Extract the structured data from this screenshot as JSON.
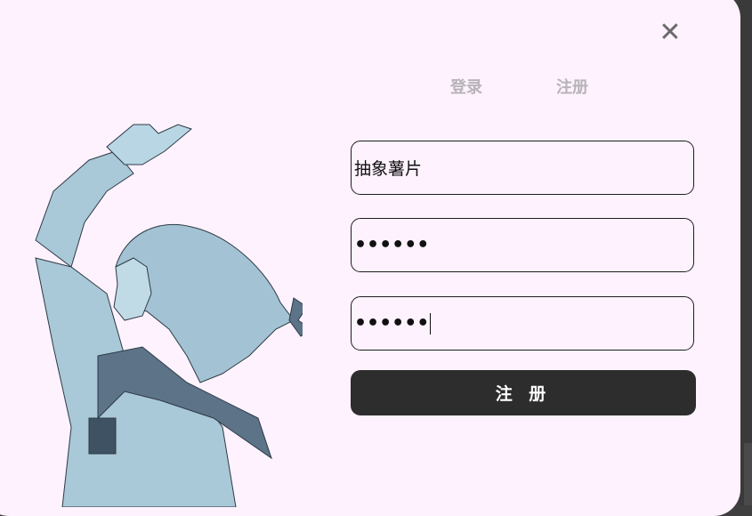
{
  "window": {
    "close_icon": "close-icon"
  },
  "tabs": [
    {
      "label": "登录",
      "active": false
    },
    {
      "label": "注册",
      "active": true
    }
  ],
  "form": {
    "username_value": "抽象薯片",
    "password_value": "••••••",
    "confirm_value": "••••••",
    "submit_label": "注 册"
  },
  "illustration": {
    "subject": "anime-girl-illustration"
  },
  "colors": {
    "dialog_bg": "#fdf2fd",
    "tab_text": "#b7b3b8",
    "button_bg": "#2d2d2d",
    "illustration_fill": "#a9c8d8",
    "illustration_dark": "#5c7388"
  }
}
